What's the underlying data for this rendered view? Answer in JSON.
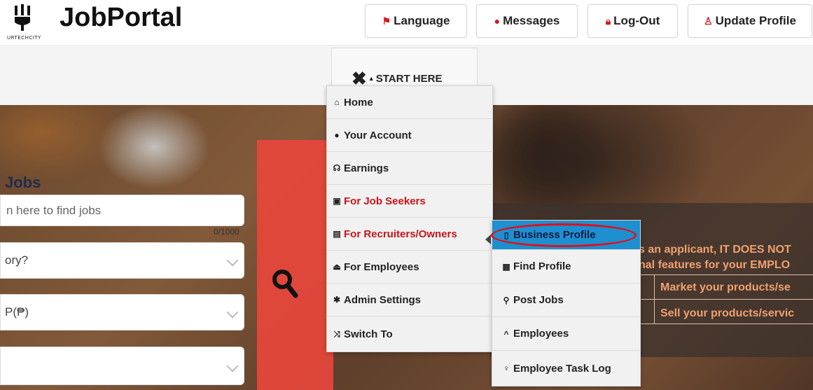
{
  "header": {
    "logo_caption": "URTECHCITY",
    "app_title": "JobPortal",
    "buttons": {
      "language": "Language",
      "messages": "Messages",
      "logout": "Log-Out",
      "update_profile": "Update Profile"
    }
  },
  "nav": {
    "start_here": "START HERE"
  },
  "menu": {
    "items": [
      {
        "label": "Home",
        "icon": "home-icon",
        "glyph": "⌂"
      },
      {
        "label": "Your Account",
        "icon": "account-icon",
        "glyph": "●"
      },
      {
        "label": "Earnings",
        "icon": "earnings-icon",
        "glyph": "☊"
      },
      {
        "label": "For Job Seekers",
        "icon": "job-seekers-icon",
        "glyph": "▣"
      },
      {
        "label": "For Recruiters/Owners",
        "icon": "recruiters-icon",
        "glyph": "▤"
      },
      {
        "label": "For Employees",
        "icon": "employees-icon",
        "glyph": "⏏"
      },
      {
        "label": "Admin Settings",
        "icon": "gear-icon",
        "glyph": "✱"
      },
      {
        "label": "Switch To",
        "icon": "shuffle-icon",
        "glyph": "⤨"
      }
    ]
  },
  "submenu": {
    "items": [
      {
        "label": "Business Profile",
        "icon": "clipboard-icon",
        "glyph": "▯"
      },
      {
        "label": "Find Profile",
        "icon": "grid-icon",
        "glyph": "▦"
      },
      {
        "label": "Post Jobs",
        "icon": "pin-icon",
        "glyph": "⚲"
      },
      {
        "label": "Employees",
        "icon": "caret-up-icon",
        "glyph": "^"
      },
      {
        "label": "Employee Task Log",
        "icon": "bulb-icon",
        "glyph": "♀"
      }
    ]
  },
  "search": {
    "title": "Jobs",
    "placeholder": "n here to find jobs",
    "counter": "0/1000",
    "category_value": "ory?",
    "currency_value": "P(₱)"
  },
  "info": {
    "line1": "s an applicant, IT DOES NOT",
    "line2": "nal features for your EMPLO",
    "cell1": "Market your products/se",
    "cell2": "Sell your products/servic"
  },
  "colors": {
    "accent_red": "#e8463c",
    "menu_active": "#1e8fcf",
    "menu_red_text": "#c8141a"
  }
}
